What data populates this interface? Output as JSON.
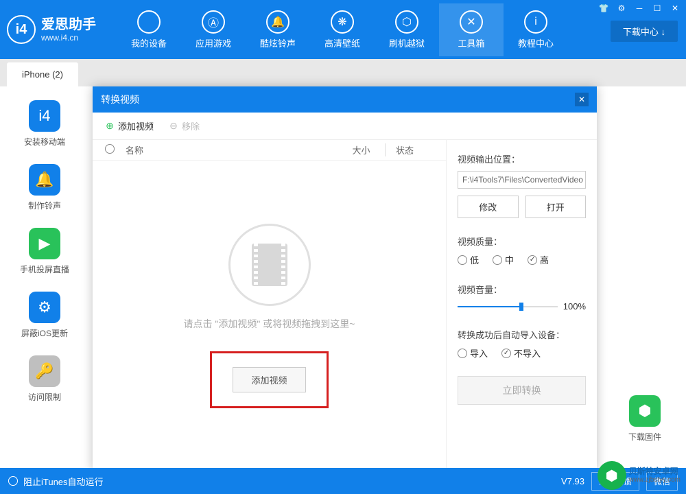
{
  "header": {
    "logo_title": "爱思助手",
    "logo_url": "www.i4.cn",
    "download_center": "下载中心 ↓"
  },
  "nav": [
    {
      "label": "我的设备",
      "icon": ""
    },
    {
      "label": "应用游戏",
      "icon": "Ⓐ"
    },
    {
      "label": "酷炫铃声",
      "icon": "🔔"
    },
    {
      "label": "高清壁纸",
      "icon": "❋"
    },
    {
      "label": "刷机越狱",
      "icon": "⬡"
    },
    {
      "label": "工具箱",
      "icon": "✕"
    },
    {
      "label": "教程中心",
      "icon": "i"
    }
  ],
  "tab": {
    "label": "iPhone (2)"
  },
  "sidebar_left": [
    {
      "label": "安装移动端",
      "color": "#1180e9",
      "icon": "i4"
    },
    {
      "label": "制作铃声",
      "color": "#1180e9",
      "icon": "🔔"
    },
    {
      "label": "手机投屏直播",
      "color": "#29c25a",
      "icon": "▶"
    },
    {
      "label": "屏蔽iOS更新",
      "color": "#1180e9",
      "icon": "⚙"
    },
    {
      "label": "访问限制",
      "color": "#bfbfbf",
      "icon": "🔑"
    }
  ],
  "sidebar_right": {
    "label": "下载固件",
    "color": "#29c25a",
    "icon": "⬢"
  },
  "modal": {
    "title": "转换视频",
    "add_video": "添加视频",
    "remove": "移除",
    "col_name": "名称",
    "col_size": "大小",
    "col_status": "状态",
    "hint": "请点击 \"添加视频\" 或将视频拖拽到这里~",
    "add_btn": "添加视频",
    "output_label": "视频输出位置：",
    "output_path": "F:\\i4Tools7\\Files\\ConvertedVideo",
    "modify": "修改",
    "open": "打开",
    "quality_label": "视频质量：",
    "quality_low": "低",
    "quality_mid": "中",
    "quality_high": "高",
    "volume_label": "视频音量：",
    "volume_value": "100%",
    "import_label": "转换成功后自动导入设备：",
    "import_yes": "导入",
    "import_no": "不导入",
    "convert": "立即转换"
  },
  "footer": {
    "itunes": "阻止iTunes自动运行",
    "version": "V7.93",
    "feedback": "意见反馈",
    "wechat": "微信"
  },
  "watermark": {
    "name": "贝斯特安卓网",
    "url": "www.zjbstyy.com"
  }
}
